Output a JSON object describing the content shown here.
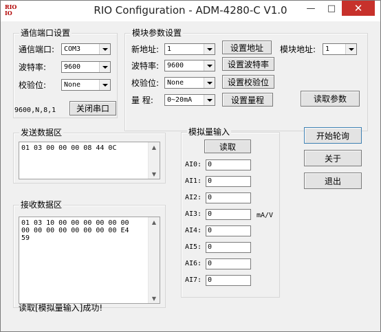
{
  "window": {
    "title": "RIO Configuration - ADM-4280-C V1.0",
    "icon_text_top": "RIO",
    "icon_text_bottom": "IO"
  },
  "comm": {
    "group_title": "通信端口设置",
    "port_label": "通信端口:",
    "port_value": "COM3",
    "baud_label": "波特率:",
    "baud_value": "9600",
    "parity_label": "校验位:",
    "parity_value": "None",
    "status": "9600,N,8,1",
    "close_button": "关闭串口"
  },
  "module": {
    "group_title": "模块参数设置",
    "new_addr_label": "新地址:",
    "new_addr_value": "1",
    "set_addr_button": "设置地址",
    "module_addr_label": "模块地址:",
    "module_addr_value": "1",
    "baud_label": "波特率:",
    "baud_value": "9600",
    "set_baud_button": "设置波特率",
    "parity_label": "校验位:",
    "parity_value": "None",
    "set_parity_button": "设置校验位",
    "range_label": "量  程:",
    "range_value": "0~20mA",
    "set_range_button": "设置量程",
    "read_params_button": "读取参数"
  },
  "send": {
    "group_title": "发送数据区",
    "content": "01 03 00 00 00 08 44 0C"
  },
  "receive": {
    "group_title": "接收数据区",
    "content": "01 03 10 00 00 00 00 00 00\n00 00 00 00 00 00 00 00 E4\n59"
  },
  "analog": {
    "group_title": "模拟量输入",
    "read_button": "读取",
    "unit": "mA/V",
    "channels": [
      {
        "label": "AI0:",
        "value": "0"
      },
      {
        "label": "AI1:",
        "value": "0"
      },
      {
        "label": "AI2:",
        "value": "0"
      },
      {
        "label": "AI3:",
        "value": "0"
      },
      {
        "label": "AI4:",
        "value": "0"
      },
      {
        "label": "AI5:",
        "value": "0"
      },
      {
        "label": "AI6:",
        "value": "0"
      },
      {
        "label": "AI7:",
        "value": "0"
      }
    ]
  },
  "side": {
    "start_poll_button": "开始轮询",
    "about_button": "关于",
    "exit_button": "退出"
  },
  "status_message": "读取[模拟量输入]成功!"
}
